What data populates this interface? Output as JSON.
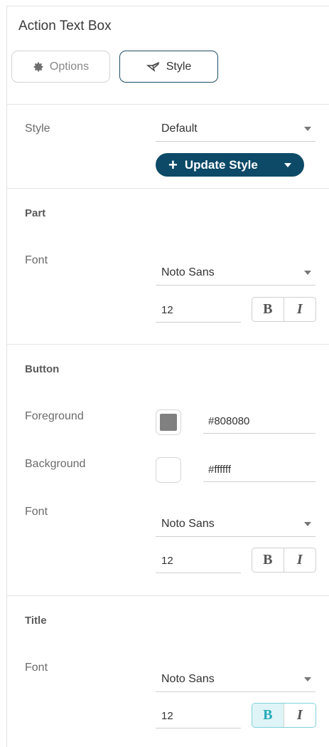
{
  "panel": {
    "title": "Action Text Box",
    "tabs": [
      {
        "label": "Options",
        "icon": "gear-icon"
      },
      {
        "label": "Style",
        "icon": "paintbrush-icon"
      }
    ]
  },
  "style": {
    "label": "Style",
    "value": "Default",
    "update_button": "Update Style"
  },
  "part": {
    "title": "Part",
    "font_label": "Font",
    "font_family": "Noto Sans",
    "font_size": "12",
    "bold": "B",
    "italic": "I"
  },
  "button": {
    "title": "Button",
    "foreground_label": "Foreground",
    "foreground_value": "#808080",
    "foreground_color": "#808080",
    "background_label": "Background",
    "background_value": "#ffffff",
    "background_color": "#ffffff",
    "font_label": "Font",
    "font_family": "Noto Sans",
    "font_size": "12",
    "bold": "B",
    "italic": "I"
  },
  "title_section": {
    "title": "Title",
    "font_label": "Font",
    "font_family": "Noto Sans",
    "font_size": "12",
    "bold": "B",
    "italic": "I",
    "bold_active": true
  },
  "colors": {
    "accent": "#0c4a67",
    "active_toggle": "#25a9b8"
  }
}
